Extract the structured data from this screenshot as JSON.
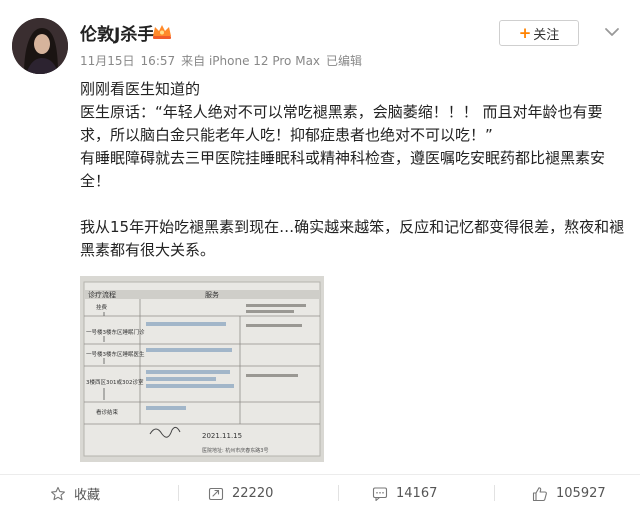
{
  "user": {
    "name": "伦敦J杀手",
    "badge_icon": "vip-crown-icon"
  },
  "meta": {
    "date": "11月15日",
    "time": "16:57",
    "source": "来自 iPhone 12 Pro Max",
    "edited": "已编辑"
  },
  "follow": {
    "plus": "+",
    "label": "关注"
  },
  "post": {
    "lines": [
      "刚刚看医生知道的",
      "医生原话：“年轻人绝对不可以常吃褪黑素，会脑萎缩！！！ 而且对年龄也有要求，所以脑白金只能老年人吃！抑郁症患者也绝对不可以吃！”",
      "有睡眠障碍就去三甲医院挂睡眠科或精神科检查，遵医嘱吃安眠药都比褪黑素安全！",
      "我从15年开始吃褪黑素到现在…确实越来越笨，反应和记忆都变得很差，熬夜和褪黑素都有很大关系。"
    ]
  },
  "photo": {
    "header_left": "诊疗流程",
    "header_right": "服务",
    "steps": [
      "挂费",
      "一号楼3楼东区睡眠门诊",
      "一号楼3楼东区睡眠医生",
      "3楼西区301或302诊室",
      "看诊结束"
    ],
    "date": "2021.11.15",
    "footer": "医院地址: 杭州市庆春东路3号"
  },
  "actions": {
    "favorite": "收藏",
    "repost": "22220",
    "comment": "14167",
    "like": "105927"
  },
  "colors": {
    "accent": "#ff8200",
    "text": "#222222",
    "meta": "#888888"
  }
}
